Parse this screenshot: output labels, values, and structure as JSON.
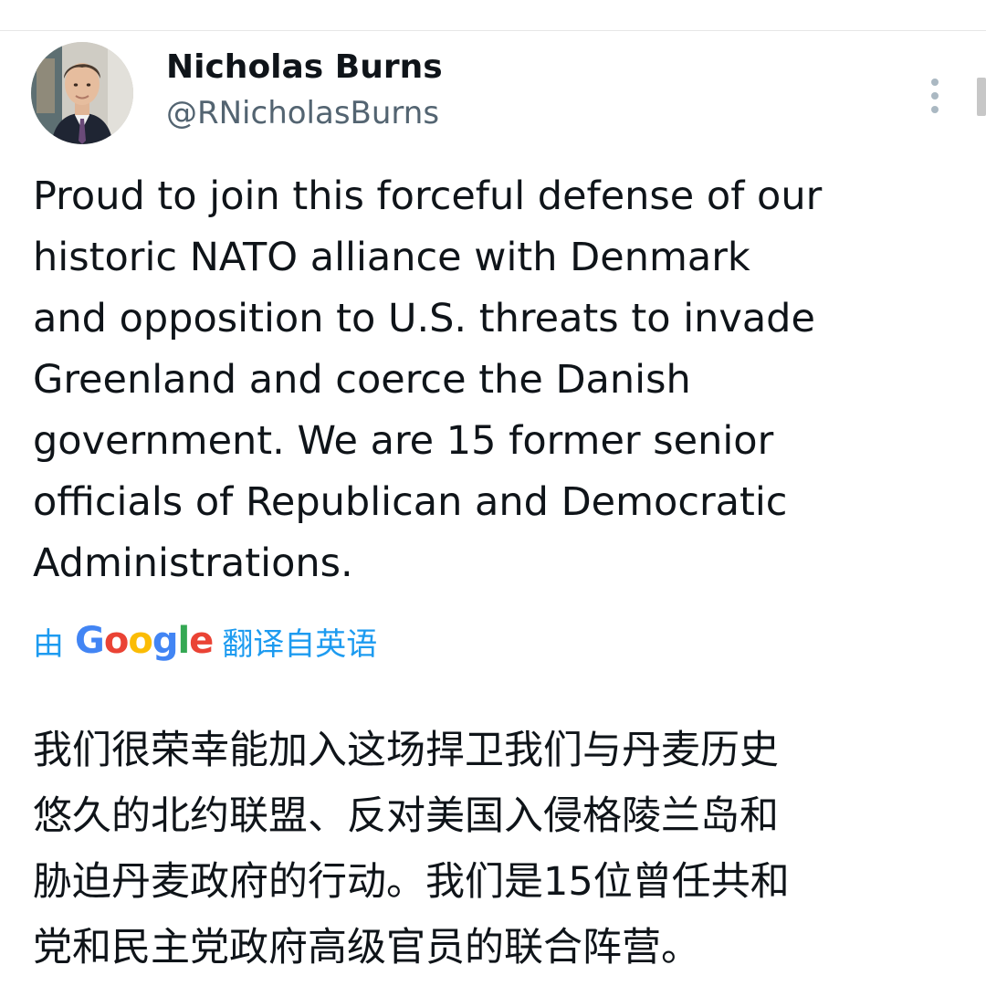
{
  "tweet": {
    "author": {
      "display_name": "Nicholas Burns",
      "handle": "@RNicholasBurns",
      "avatar_icon": "profile-photo"
    },
    "more_icon": "more-vertical-icon",
    "text_lines": [
      "Proud to join this forceful defense of our",
      "historic NATO alliance with Denmark",
      "and opposition to U.S. threats to invade",
      "Greenland and coerce the Danish",
      "government.  We are 15 former senior",
      "officials of Republican and Democratic",
      "Administrations."
    ],
    "translation": {
      "prefix": "由",
      "provider": "Google",
      "suffix": "翻译自英语",
      "link_color": "#1d9bf0",
      "google_colors": [
        "#4285f4",
        "#ea4335",
        "#fbbc05",
        "#4285f4",
        "#34a853",
        "#ea4335"
      ]
    },
    "translated_lines": [
      "我们很荣幸能加入这场捍卫我们与丹麦历史",
      "悠久的北约联盟、反对美国入侵格陵兰岛和",
      "胁迫丹麦政府的行动。我们是15位曾任共和",
      "党和民主党政府高级官员的联合阵营。"
    ]
  }
}
